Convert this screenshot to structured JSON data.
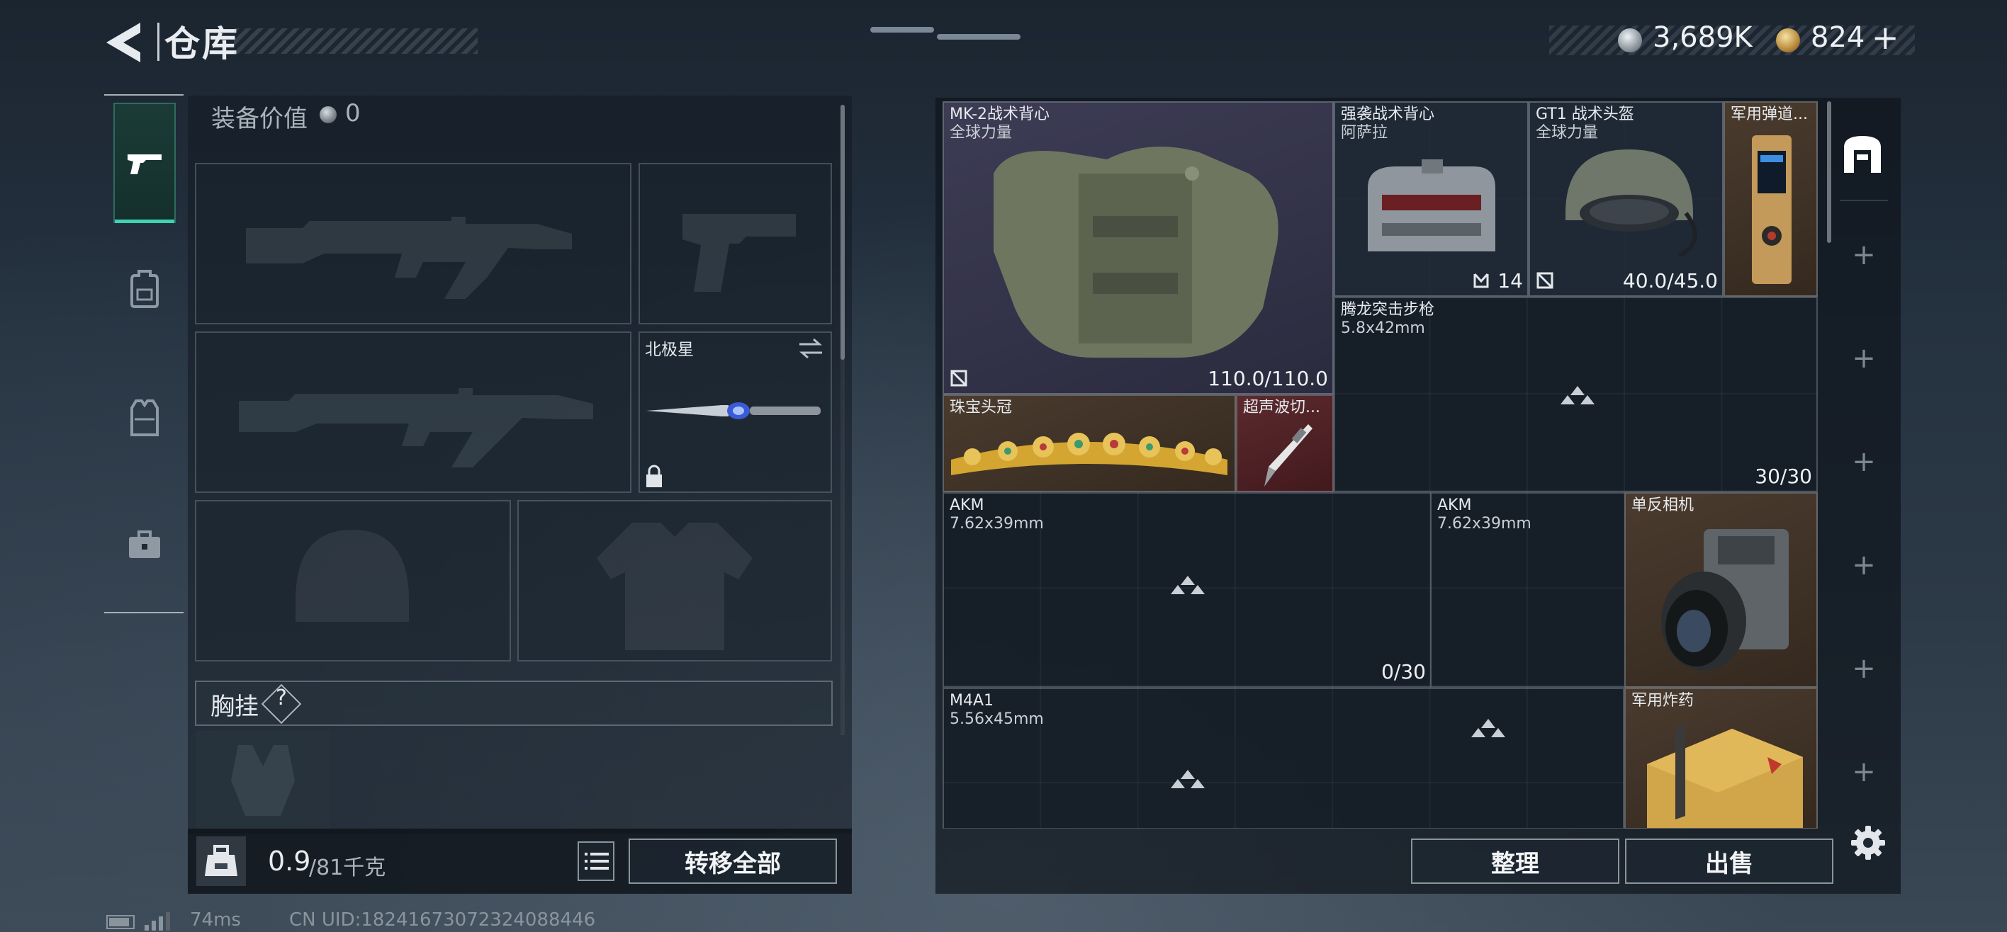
{
  "header": {
    "title": "仓库",
    "silver_amount": "3,689K",
    "gold_amount": "824"
  },
  "tabs": [
    {
      "icon": "pistol-icon",
      "active": true
    },
    {
      "icon": "backpack-icon",
      "active": false
    },
    {
      "icon": "vest-icon",
      "active": false
    },
    {
      "icon": "briefcase-icon",
      "active": false
    }
  ],
  "loadout": {
    "equip_value_label": "装备价值",
    "equip_value": "0",
    "melee_name": "北极星",
    "chest_rig_label": "胸挂",
    "help_label": "?",
    "weight_current": "0.9",
    "weight_max": "/81千克",
    "transfer_all_label": "转移全部"
  },
  "stash": {
    "items": [
      {
        "name": "MK-2战术背心",
        "sub": "全球力量",
        "stat": "110.0/110.0",
        "rarity": "purple"
      },
      {
        "name": "强袭战术背心",
        "sub": "阿萨拉",
        "stat": "14",
        "rarity": "dark"
      },
      {
        "name": "GT1 战术头盔",
        "sub": "全球力量",
        "stat": "40.0/45.0",
        "rarity": "dark"
      },
      {
        "name": "军用弹道...",
        "sub": "",
        "stat": "",
        "rarity": "brown"
      },
      {
        "name": "腾龙突击步枪",
        "sub": "5.8x42mm",
        "stat": "30/30",
        "rarity": "weapon"
      },
      {
        "name": "珠宝头冠",
        "sub": "",
        "stat": "",
        "rarity": "brown"
      },
      {
        "name": "超声波切...",
        "sub": "",
        "stat": "",
        "rarity": "red"
      },
      {
        "name": "AKM",
        "sub": "7.62x39mm",
        "stat": "0/30",
        "rarity": "weapon"
      },
      {
        "name": "AKM",
        "sub": "7.62x39mm",
        "stat": "",
        "rarity": "weapon"
      },
      {
        "name": "单反相机",
        "sub": "",
        "stat": "",
        "rarity": "brown"
      },
      {
        "name": "M4A1",
        "sub": "5.56x45mm",
        "stat": "",
        "rarity": "weapon"
      },
      {
        "name": "军用炸药",
        "sub": "",
        "stat": "",
        "rarity": "brown"
      }
    ],
    "sort_label": "整理",
    "sell_label": "出售"
  },
  "footer": {
    "ping": "74ms",
    "uid": "CN UID:18241673072324088446"
  },
  "colors": {
    "accent": "#3fd2b3",
    "rarity_purple": "#3d3c55",
    "rarity_gold": "#4a3b2e",
    "rarity_red": "#5a2a2e"
  }
}
